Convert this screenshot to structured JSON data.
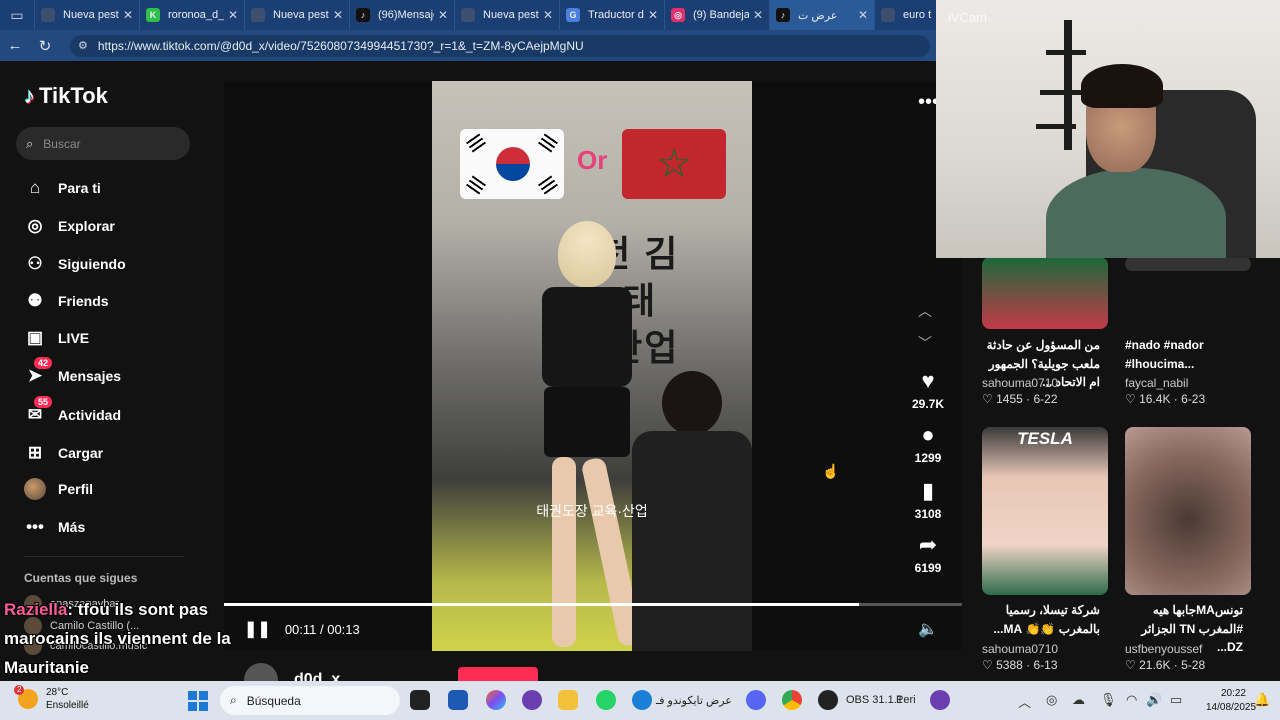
{
  "browser": {
    "tabs": [
      {
        "title": "Nueva pesta",
        "color": "#3d4f6e",
        "glyph": ""
      },
      {
        "title": "roronoa_d_s",
        "color": "#2fbf4a",
        "glyph": "K"
      },
      {
        "title": "Nueva pesta",
        "color": "#3d4f6e",
        "glyph": ""
      },
      {
        "title": "(96)Mensaje",
        "color": "#111111",
        "glyph": "♪"
      },
      {
        "title": "Nueva pesta",
        "color": "#3d4f6e",
        "glyph": ""
      },
      {
        "title": "Traductor de",
        "color": "#4a7fe0",
        "glyph": "G"
      },
      {
        "title": "(9) Bandeja",
        "color": "#e1306c",
        "glyph": "◎"
      },
      {
        "title": "عرض ت",
        "color": "#111111",
        "glyph": "♪"
      },
      {
        "title": "euro t",
        "color": "#3d4f6e",
        "glyph": ""
      }
    ],
    "url": "https://www.tiktok.com/@d0d_x/video/7526080734994451730?_r=1&_t=ZM-8yCAejpMgNU"
  },
  "sidebar": {
    "logo": "TikTok",
    "search_placeholder": "Buscar",
    "items": [
      {
        "label": "Para ti",
        "icon": "⌂",
        "badge": ""
      },
      {
        "label": "Explorar",
        "icon": "◎",
        "badge": ""
      },
      {
        "label": "Siguiendo",
        "icon": "⚇",
        "badge": ""
      },
      {
        "label": "Friends",
        "icon": "⚉",
        "badge": ""
      },
      {
        "label": "LIVE",
        "icon": "▣",
        "badge": ""
      },
      {
        "label": "Mensajes",
        "icon": "➤",
        "badge": "42"
      },
      {
        "label": "Actividad",
        "icon": "✉",
        "badge": "55"
      },
      {
        "label": "Cargar",
        "icon": "⊞",
        "badge": ""
      },
      {
        "label": "Perfil",
        "icon": "",
        "badge": ""
      },
      {
        "label": "Más",
        "icon": "•••",
        "badge": ""
      }
    ],
    "following_title": "Cuentas que sigues",
    "following": [
      "anaszanaybar",
      "Camilo Castillo (...",
      "camilocastillo.music"
    ]
  },
  "video": {
    "overlay_or": "Or",
    "time": "00:11 / 00:13",
    "progress": 0.86,
    "author": "d0d_x",
    "likes": "29.7K",
    "comments": "1299",
    "saves": "3108",
    "shares": "6199"
  },
  "recommended": [
    {
      "caption": "من المسؤول عن حادثة ملعب جويلية؟ الجمهور ام الاتحاد ...",
      "user": "sahouma0710",
      "likes": "1455",
      "date": "6-22"
    },
    {
      "caption": "#nado #nador #lhoucima...",
      "user": "faycal_nabil",
      "likes": "16.4K",
      "date": "6-23"
    },
    {
      "caption": "شركة تيسلا، رسميا بالمغرب 👏👏 MA...",
      "user": "sahouma0710",
      "likes": "5388",
      "date": "6-13",
      "thumb_text": "TESLA"
    },
    {
      "caption": "تونسMAجابها هيه #المغرب TN الجزائر DZ...",
      "user": "usfbenyoussef",
      "likes": "21.6K",
      "date": "5-28"
    }
  ],
  "webcam": {
    "watermark": "iVCam"
  },
  "chat": {
    "username": "Raziella",
    "message": ": tfou ils sont pas marocains ils viennent de la Mauritanie"
  },
  "taskbar": {
    "temp": "28°C",
    "weather": "Ensoleillé",
    "weather_badge": "2",
    "search": "Búsqueda",
    "active_label": "عرض تايكوندو فـ",
    "obs_label": "OBS 31.1.1",
    "obs_suffix": "Peri",
    "time": "20:22",
    "date": "14/08/2025"
  }
}
